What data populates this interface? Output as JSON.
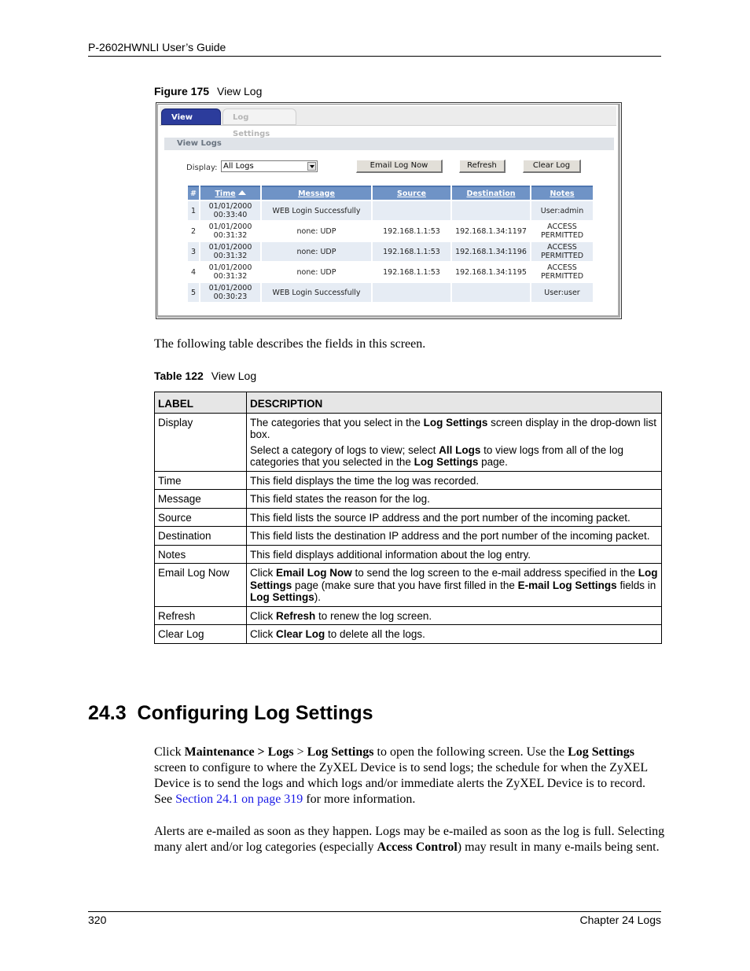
{
  "header": {
    "title": "P-2602HWNLI User’s Guide"
  },
  "figure": {
    "number": "Figure 175",
    "title": "View Log",
    "tabs": [
      {
        "label": "View Log",
        "active": true
      },
      {
        "label": "Log Settings",
        "active": false
      }
    ],
    "section_title": "View Logs",
    "display_label": "Display:",
    "display_value": "All Logs",
    "buttons": {
      "email": "Email Log Now",
      "refresh": "Refresh",
      "clear": "Clear Log"
    },
    "columns": [
      "#",
      "Time",
      "Message",
      "Source",
      "Destination",
      "Notes"
    ],
    "rows": [
      {
        "num": "1",
        "date": "01/01/2000",
        "time": "00:33:40",
        "message": "WEB Login Successfully",
        "source": "",
        "destination": "",
        "notes1": "User:admin",
        "notes2": ""
      },
      {
        "num": "2",
        "date": "01/01/2000",
        "time": "00:31:32",
        "message": "none: UDP",
        "source": "192.168.1.1:53",
        "destination": "192.168.1.34:1197",
        "notes1": "ACCESS",
        "notes2": "PERMITTED"
      },
      {
        "num": "3",
        "date": "01/01/2000",
        "time": "00:31:32",
        "message": "none: UDP",
        "source": "192.168.1.1:53",
        "destination": "192.168.1.34:1196",
        "notes1": "ACCESS",
        "notes2": "PERMITTED"
      },
      {
        "num": "4",
        "date": "01/01/2000",
        "time": "00:31:32",
        "message": "none: UDP",
        "source": "192.168.1.1:53",
        "destination": "192.168.1.34:1195",
        "notes1": "ACCESS",
        "notes2": "PERMITTED"
      },
      {
        "num": "5",
        "date": "01/01/2000",
        "time": "00:30:23",
        "message": "WEB Login Successfully",
        "source": "",
        "destination": "",
        "notes1": "User:user",
        "notes2": ""
      }
    ]
  },
  "intro_text": "The following table describes the fields in this screen.",
  "table": {
    "number": "Table 122",
    "title": "View Log",
    "headers": [
      "LABEL",
      "DESCRIPTION"
    ],
    "rows": [
      {
        "label": "Display",
        "desc": [
          [
            {
              "t": "The categories that you select in the "
            },
            {
              "b": "Log Settings"
            },
            {
              "t": " screen display in the drop-down list box."
            }
          ],
          [
            {
              "t": "Select a category of logs to view; select "
            },
            {
              "b": "All Logs"
            },
            {
              "t": " to view logs from all of the log categories that you selected in the "
            },
            {
              "b": "Log Settings"
            },
            {
              "t": " page."
            }
          ]
        ]
      },
      {
        "label": "Time",
        "desc": [
          [
            {
              "t": "This field displays the time the log was recorded."
            }
          ]
        ]
      },
      {
        "label": "Message",
        "desc": [
          [
            {
              "t": "This field states the reason for the log."
            }
          ]
        ]
      },
      {
        "label": "Source",
        "desc": [
          [
            {
              "t": "This field lists the source IP address and the port number of the incoming packet."
            }
          ]
        ]
      },
      {
        "label": "Destination",
        "desc": [
          [
            {
              "t": "This field lists the destination IP address and the port number of the incoming packet."
            }
          ]
        ]
      },
      {
        "label": "Notes",
        "desc": [
          [
            {
              "t": "This field displays additional information about the log entry."
            }
          ]
        ]
      },
      {
        "label": "Email Log Now",
        "desc": [
          [
            {
              "t": "Click "
            },
            {
              "b": "Email Log Now"
            },
            {
              "t": " to send the log screen to the e-mail address specified in the "
            },
            {
              "b": "Log Settings"
            },
            {
              "t": " page (make sure that you have first filled in the "
            },
            {
              "b": "E-mail Log Settings"
            },
            {
              "t": " fields in "
            },
            {
              "b": "Log Settings"
            },
            {
              "t": ")."
            }
          ]
        ]
      },
      {
        "label": "Refresh",
        "desc": [
          [
            {
              "t": "Click "
            },
            {
              "b": "Refresh"
            },
            {
              "t": " to renew the log screen."
            }
          ]
        ]
      },
      {
        "label": "Clear Log",
        "desc": [
          [
            {
              "t": "Click "
            },
            {
              "b": "Clear Log"
            },
            {
              "t": " to delete all the logs."
            }
          ]
        ]
      }
    ]
  },
  "section": {
    "heading": "24.3  Configuring Log Settings",
    "p1": [
      {
        "t": "Click "
      },
      {
        "b": "Maintenance > Logs"
      },
      {
        "t": " > "
      },
      {
        "b": "Log Settings"
      },
      {
        "t": " to open the following screen. Use the "
      },
      {
        "b": "Log Settings"
      },
      {
        "t": " screen to configure to where the ZyXEL Device is to send logs; the schedule for when the ZyXEL Device is to send the logs and which logs and/or immediate alerts the ZyXEL Device is to record. See "
      },
      {
        "link": "Section 24.1 on page 319"
      },
      {
        "t": " for more information."
      }
    ],
    "p2": [
      {
        "t": "Alerts are e-mailed as soon as they happen. Logs may be e-mailed as soon as the log is full. Selecting many alert and/or log categories (especially "
      },
      {
        "b": "Access Control"
      },
      {
        "t": ") may result in many e-mails being sent."
      }
    ]
  },
  "footer": {
    "page": "320",
    "chapter": "Chapter 24 Logs"
  }
}
